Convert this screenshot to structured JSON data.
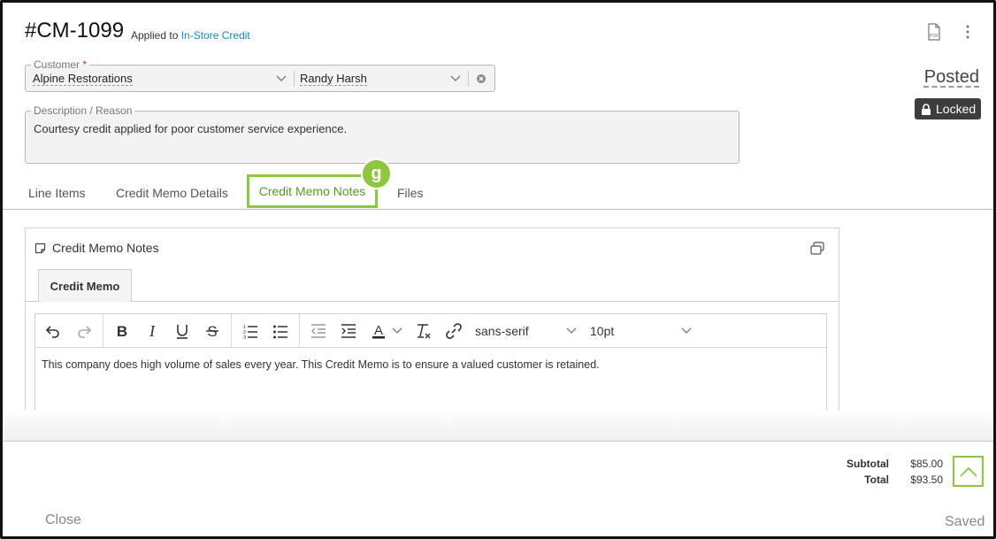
{
  "header": {
    "title": "#CM-1099",
    "applied_prefix": "Applied to",
    "applied_link": "In-Store Credit",
    "status": "Posted",
    "lock_label": "Locked"
  },
  "customer": {
    "legend": "Customer",
    "required_mark": "*",
    "company": "Alpine Restorations",
    "contact": "Randy Harsh"
  },
  "description": {
    "legend": "Description / Reason",
    "value": "Courtesy credit applied for poor customer service experience."
  },
  "tabs": [
    {
      "label": "Line Items"
    },
    {
      "label": "Credit Memo Details"
    },
    {
      "label": "Credit Memo Notes"
    },
    {
      "label": "Files"
    }
  ],
  "badge": "g",
  "notes": {
    "title": "Credit Memo Notes",
    "subtab": "Credit Memo",
    "font_family": "sans-serif",
    "font_size": "10pt",
    "content": "This company does high volume of sales every year. This Credit Memo is to ensure a valued customer is retained."
  },
  "totals": {
    "subtotal_label": "Subtotal",
    "subtotal_value": "$85.00",
    "total_label": "Total",
    "total_value": "$93.50"
  },
  "footer": {
    "close_label": "Close",
    "saved_label": "Saved"
  },
  "colors": {
    "accent_green": "#8dc63f",
    "link_blue": "#1a8bbf",
    "lock_bg": "#3d3d3d"
  }
}
